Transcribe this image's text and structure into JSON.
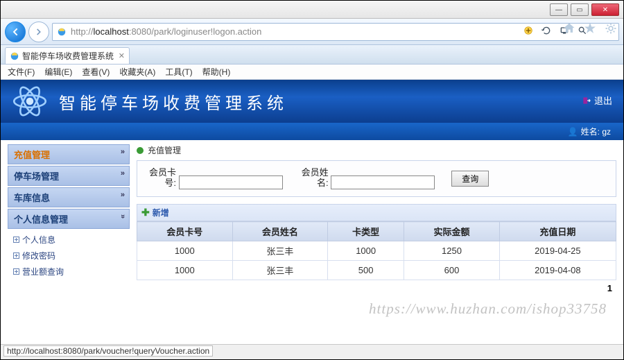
{
  "window": {
    "btn_min": "—",
    "btn_max": "▭",
    "btn_close": "✕"
  },
  "nav": {
    "url_prefix": "http://",
    "url_host": "localhost",
    "url_rest": ":8080/park/loginuser!logon.action"
  },
  "tab_title": "智能停车场收费管理系统",
  "menus": [
    "文件(F)",
    "编辑(E)",
    "查看(V)",
    "收藏夹(A)",
    "工具(T)",
    "帮助(H)"
  ],
  "banner": {
    "title": "智能停车场收费管理系统",
    "logout": "退出",
    "user_label": "姓名:",
    "user": "gz"
  },
  "sidebar": {
    "heads": [
      "充值管理",
      "停车场管理",
      "车库信息",
      "个人信息管理"
    ],
    "sub": [
      "个人信息",
      "修改密码",
      "营业额查询"
    ]
  },
  "crumb": "充值管理",
  "search": {
    "label_card": "会员卡号:",
    "label_name": "会员姓名:",
    "btn": "查询"
  },
  "addbar": "新增",
  "table": {
    "headers": [
      "会员卡号",
      "会员姓名",
      "卡类型",
      "实际金额",
      "充值日期"
    ],
    "rows": [
      [
        "1000",
        "张三丰",
        "1000",
        "1250",
        "2019-04-25"
      ],
      [
        "1000",
        "张三丰",
        "500",
        "600",
        "2019-04-08"
      ]
    ]
  },
  "pager": "1",
  "watermark": "https://www.huzhan.com/ishop33758",
  "status_url": "http://localhost:8080/park/voucher!queryVoucher.action"
}
